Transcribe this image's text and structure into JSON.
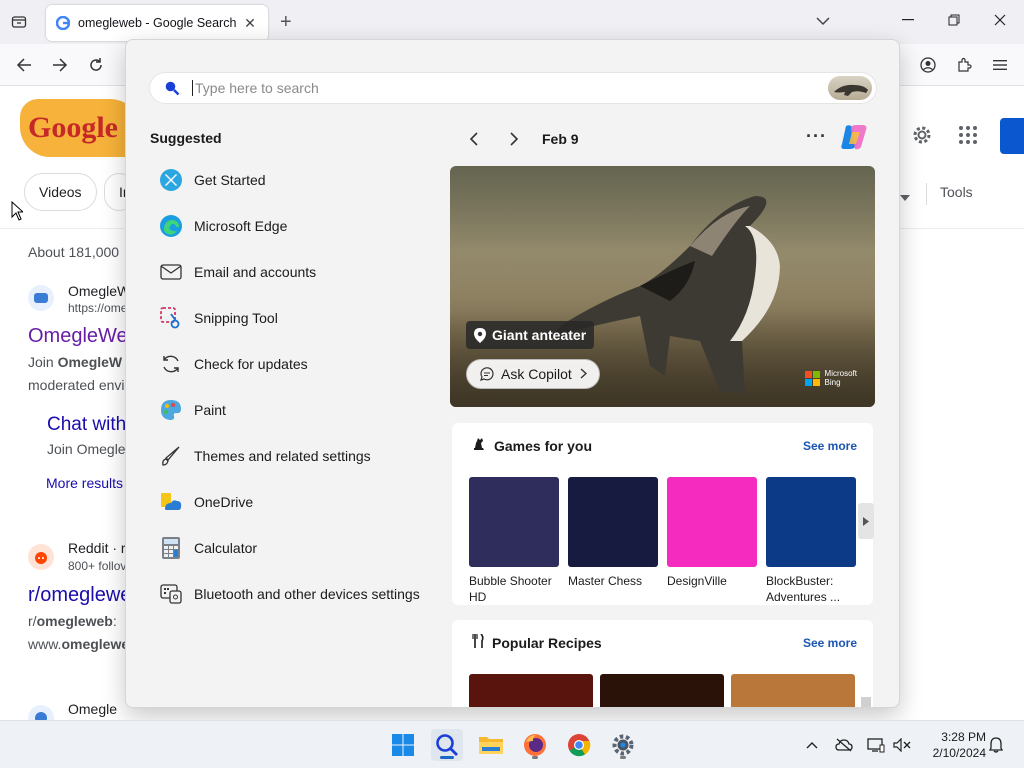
{
  "browser": {
    "tab_title": "omegleweb - Google Search",
    "tab_close": "✕",
    "new_tab": "+"
  },
  "google": {
    "logo_text": "Google",
    "chips": [
      "Videos",
      "In"
    ],
    "tools": "Tools",
    "results_count": "About 181,000",
    "result1": {
      "site": "OmegleW",
      "url": "https://ome",
      "title": "OmegleWe",
      "snippet_line1_prefix": "Join ",
      "snippet_line1_bold": "OmegleW",
      "snippet_line2": "moderated envi",
      "sublink_title": "Chat with",
      "sublink_snippet": "Join Omegle",
      "more_results": "More results"
    },
    "result2": {
      "site": "Reddit · r",
      "followers": "800+ follov",
      "title": "r/omegleweb",
      "snippet_line1_prefix": "r/",
      "snippet_line1_bold": "omegleweb",
      "snippet_line1_suffix": ":",
      "snippet_line2_prefix": "www.",
      "snippet_line2_bold": "omeglewe"
    },
    "result3": {
      "site": "Omegle"
    }
  },
  "search_panel": {
    "placeholder": "Type here to search",
    "suggested_title": "Suggested",
    "suggested": [
      {
        "label": "Get Started",
        "icon": "get-started-icon"
      },
      {
        "label": "Microsoft Edge",
        "icon": "edge-icon"
      },
      {
        "label": "Email and accounts",
        "icon": "mail-icon"
      },
      {
        "label": "Snipping Tool",
        "icon": "snipping-tool-icon"
      },
      {
        "label": "Check for updates",
        "icon": "update-icon"
      },
      {
        "label": "Paint",
        "icon": "paint-icon"
      },
      {
        "label": "Themes and related settings",
        "icon": "brush-icon"
      },
      {
        "label": "OneDrive",
        "icon": "onedrive-icon"
      },
      {
        "label": "Calculator",
        "icon": "calculator-icon"
      },
      {
        "label": "Bluetooth and other devices settings",
        "icon": "bluetooth-devices-icon"
      }
    ],
    "date": "Feb 9",
    "more": "···",
    "hero": {
      "location_label": "Giant anteater",
      "ask_copilot": "Ask Copilot",
      "bing_line1": "Microsoft",
      "bing_line2": "Bing"
    },
    "games": {
      "title": "Games for you",
      "see_more": "See more",
      "items": [
        {
          "caption_line1": "Bubble Shooter",
          "caption_line2": "HD",
          "color": "#2f2d5c"
        },
        {
          "caption_line1": "Master Chess",
          "caption_line2": "",
          "color": "#161b3f"
        },
        {
          "caption_line1": "DesignVille",
          "caption_line2": "",
          "color": "#f52bbf"
        },
        {
          "caption_line1": "BlockBuster:",
          "caption_line2": "Adventures ...",
          "color": "#0c3a86"
        }
      ]
    },
    "recipes": {
      "title": "Popular Recipes",
      "see_more": "See more",
      "colors": [
        "#5a140e",
        "#2a1208",
        "#b9773a"
      ]
    }
  },
  "taskbar": {
    "time": "3:28 PM",
    "date": "2/10/2024"
  }
}
